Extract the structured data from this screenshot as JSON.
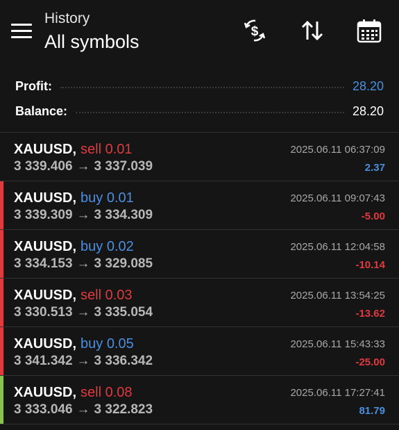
{
  "header": {
    "subtitle": "History",
    "title": "All symbols",
    "icons": [
      "menu-icon",
      "dollar-exchange-icon",
      "sort-arrows-icon",
      "calendar-icon"
    ]
  },
  "summary": {
    "profit_label": "Profit:",
    "profit_value": "28.20",
    "balance_label": "Balance:",
    "balance_value": "28.20"
  },
  "colors": {
    "background": "#151515",
    "sell": "#e0393e",
    "buy": "#4a8fe0",
    "loss_bar": "#e0393e",
    "profit_bar": "#8bc34a"
  },
  "trades": [
    {
      "symbol": "XAUUSD",
      "comma": ",",
      "type": "sell 0.01",
      "open": "3 339.406",
      "arrow": "→",
      "close": "3 337.039",
      "time": "2025.06.11 06:37:09",
      "profit": "2.37"
    },
    {
      "symbol": "XAUUSD",
      "comma": ",",
      "type": "buy 0.01",
      "open": "3 339.309",
      "arrow": "→",
      "close": "3 334.309",
      "time": "2025.06.11 09:07:43",
      "profit": "-5.00"
    },
    {
      "symbol": "XAUUSD",
      "comma": ",",
      "type": "buy 0.02",
      "open": "3 334.153",
      "arrow": "→",
      "close": "3 329.085",
      "time": "2025.06.11 12:04:58",
      "profit": "-10.14"
    },
    {
      "symbol": "XAUUSD",
      "comma": ",",
      "type": "sell 0.03",
      "open": "3 330.513",
      "arrow": "→",
      "close": "3 335.054",
      "time": "2025.06.11 13:54:25",
      "profit": "-13.62"
    },
    {
      "symbol": "XAUUSD",
      "comma": ",",
      "type": "buy 0.05",
      "open": "3 341.342",
      "arrow": "→",
      "close": "3 336.342",
      "time": "2025.06.11 15:43:33",
      "profit": "-25.00"
    },
    {
      "symbol": "XAUUSD",
      "comma": ",",
      "type": "sell 0.08",
      "open": "3 333.046",
      "arrow": "→",
      "close": "3 322.823",
      "time": "2025.06.11 17:27:41",
      "profit": "81.79"
    }
  ]
}
